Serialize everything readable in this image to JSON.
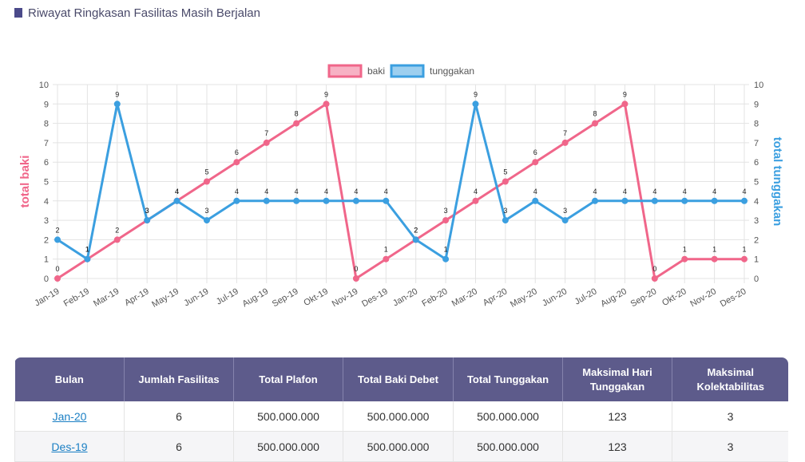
{
  "section": {
    "title": "Riwayat Ringkasan Fasilitas Masih Berjalan"
  },
  "colors": {
    "baki": "#f0668a",
    "tunggakan": "#3b9fe0",
    "header_bg": "#5d5b8b",
    "title_square": "#4b4a8a"
  },
  "chart_data": {
    "type": "line",
    "categories": [
      "Jan-19",
      "Feb-19",
      "Mar-19",
      "Apr-19",
      "May-19",
      "Jun-19",
      "Jul-19",
      "Aug-19",
      "Sep-19",
      "Okt-19",
      "Nov-19",
      "Des-19",
      "Jan-20",
      "Feb-20",
      "Mar-20",
      "Apr-20",
      "May-20",
      "Jun-20",
      "Jul-20",
      "Aug-20",
      "Sep-20",
      "Okt-20",
      "Nov-20",
      "Des-20"
    ],
    "series": [
      {
        "name": "baki",
        "axis": "left",
        "values": [
          0,
          1,
          2,
          3,
          4,
          5,
          6,
          7,
          8,
          9,
          0,
          1,
          2,
          3,
          4,
          5,
          6,
          7,
          8,
          9,
          0,
          1,
          1,
          1
        ]
      },
      {
        "name": "tunggakan",
        "axis": "right",
        "values": [
          2,
          1,
          9,
          3,
          4,
          3,
          4,
          4,
          4,
          4,
          4,
          4,
          2,
          1,
          9,
          3,
          4,
          3,
          4,
          4,
          4,
          4,
          4,
          4
        ]
      }
    ],
    "ylabel_left": "total baki",
    "ylabel_right": "total tunggakan",
    "ylim": [
      0,
      10
    ],
    "yticks": [
      "0",
      "1",
      "2",
      "3",
      "4",
      "5",
      "6",
      "7",
      "8",
      "9",
      "10"
    ],
    "legend_position": "top-center",
    "grid": true,
    "data_labels": true
  },
  "table": {
    "headers": [
      "Bulan",
      "Jumlah Fasilitas",
      "Total Plafon",
      "Total Baki Debet",
      "Total Tunggakan",
      "Maksimal Hari Tunggakan",
      "Maksimal Kolektabilitas"
    ],
    "rows": [
      {
        "bulan": "Jan-20",
        "jumlah": "6",
        "plafon": "500.000.000",
        "baki": "500.000.000",
        "tunggakan": "500.000.000",
        "hari": "123",
        "kolek": "3"
      },
      {
        "bulan": "Des-19",
        "jumlah": "6",
        "plafon": "500.000.000",
        "baki": "500.000.000",
        "tunggakan": "500.000.000",
        "hari": "123",
        "kolek": "3"
      }
    ]
  }
}
